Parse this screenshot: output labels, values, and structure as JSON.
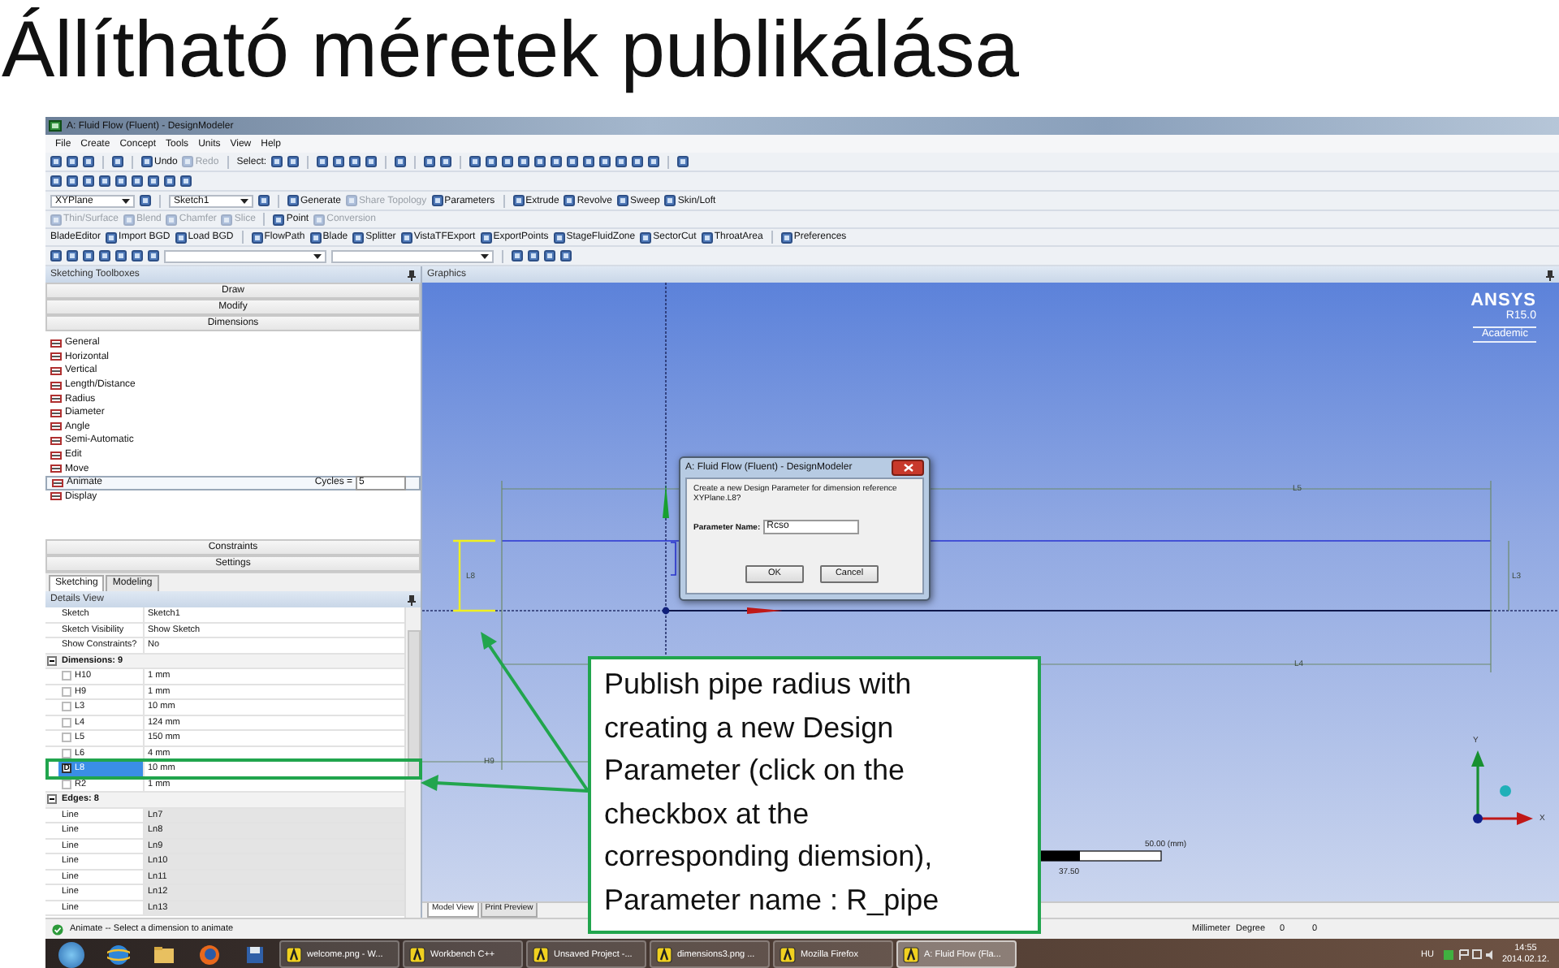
{
  "slide_title": "Állítható méretek publikálása",
  "window": {
    "title": "A: Fluid Flow (Fluent) - DesignModeler"
  },
  "menu": [
    "File",
    "Create",
    "Concept",
    "Tools",
    "Units",
    "View",
    "Help"
  ],
  "toolbars": [
    [
      {
        "kind": "icon"
      },
      {
        "kind": "icon"
      },
      {
        "kind": "icon"
      },
      {
        "kind": "separator"
      },
      {
        "kind": "icon"
      },
      {
        "kind": "separator"
      },
      {
        "kind": "button",
        "label": "Undo",
        "disabled": false
      },
      {
        "kind": "button",
        "label": "Redo",
        "disabled": true
      },
      {
        "kind": "separator"
      },
      {
        "kind": "label",
        "label": "Select:"
      },
      {
        "kind": "icon"
      },
      {
        "kind": "icon"
      },
      {
        "kind": "separator"
      },
      {
        "kind": "icon"
      },
      {
        "kind": "icon"
      },
      {
        "kind": "icon"
      },
      {
        "kind": "icon"
      },
      {
        "kind": "separator"
      },
      {
        "kind": "icon"
      },
      {
        "kind": "separator"
      },
      {
        "kind": "icon"
      },
      {
        "kind": "icon"
      },
      {
        "kind": "separator"
      },
      {
        "kind": "icon"
      },
      {
        "kind": "icon"
      },
      {
        "kind": "icon"
      },
      {
        "kind": "icon"
      },
      {
        "kind": "icon"
      },
      {
        "kind": "icon"
      },
      {
        "kind": "icon"
      },
      {
        "kind": "icon"
      },
      {
        "kind": "icon"
      },
      {
        "kind": "icon"
      },
      {
        "kind": "icon"
      },
      {
        "kind": "icon"
      },
      {
        "kind": "separator"
      },
      {
        "kind": "icon"
      }
    ],
    [
      {
        "kind": "icon"
      },
      {
        "kind": "icon"
      },
      {
        "kind": "icon"
      },
      {
        "kind": "icon"
      },
      {
        "kind": "icon"
      },
      {
        "kind": "icon"
      },
      {
        "kind": "icon"
      },
      {
        "kind": "icon"
      },
      {
        "kind": "icon"
      }
    ],
    [
      {
        "kind": "dropdown",
        "value": "XYPlane"
      },
      {
        "kind": "icon"
      },
      {
        "kind": "separator"
      },
      {
        "kind": "dropdown",
        "value": "Sketch1"
      },
      {
        "kind": "icon"
      },
      {
        "kind": "separator"
      },
      {
        "kind": "button",
        "label": "Generate",
        "disabled": false
      },
      {
        "kind": "button",
        "label": "Share Topology",
        "disabled": true
      },
      {
        "kind": "button",
        "label": "Parameters",
        "disabled": false
      },
      {
        "kind": "separator"
      },
      {
        "kind": "button",
        "label": "Extrude",
        "disabled": false
      },
      {
        "kind": "button",
        "label": "Revolve",
        "disabled": false
      },
      {
        "kind": "button",
        "label": "Sweep",
        "disabled": false
      },
      {
        "kind": "button",
        "label": "Skin/Loft",
        "disabled": false
      }
    ],
    [
      {
        "kind": "button",
        "label": "Thin/Surface",
        "disabled": true
      },
      {
        "kind": "button",
        "label": "Blend",
        "disabled": true
      },
      {
        "kind": "button",
        "label": "Chamfer",
        "disabled": true
      },
      {
        "kind": "button",
        "label": "Slice",
        "disabled": true
      },
      {
        "kind": "separator"
      },
      {
        "kind": "button",
        "label": "Point",
        "disabled": false
      },
      {
        "kind": "button",
        "label": "Conversion",
        "disabled": true
      }
    ],
    [
      {
        "kind": "label",
        "label": "BladeEditor"
      },
      {
        "kind": "button",
        "label": "Import BGD",
        "disabled": false
      },
      {
        "kind": "button",
        "label": "Load BGD",
        "disabled": false
      },
      {
        "kind": "separator"
      },
      {
        "kind": "button",
        "label": "FlowPath",
        "disabled": false
      },
      {
        "kind": "button",
        "label": "Blade",
        "disabled": false
      },
      {
        "kind": "button",
        "label": "Splitter",
        "disabled": false
      },
      {
        "kind": "button",
        "label": "VistaTFExport",
        "disabled": false
      },
      {
        "kind": "button",
        "label": "ExportPoints",
        "disabled": false
      },
      {
        "kind": "button",
        "label": "StageFluidZone",
        "disabled": false
      },
      {
        "kind": "button",
        "label": "SectorCut",
        "disabled": false
      },
      {
        "kind": "button",
        "label": "ThroatArea",
        "disabled": false
      },
      {
        "kind": "separator"
      },
      {
        "kind": "button",
        "label": "Preferences",
        "disabled": false
      }
    ],
    [
      {
        "kind": "icon"
      },
      {
        "kind": "icon"
      },
      {
        "kind": "icon"
      },
      {
        "kind": "icon"
      },
      {
        "kind": "icon"
      },
      {
        "kind": "icon"
      },
      {
        "kind": "icon"
      },
      {
        "kind": "combo"
      },
      {
        "kind": "combo"
      },
      {
        "kind": "separator"
      },
      {
        "kind": "icon"
      },
      {
        "kind": "icon"
      },
      {
        "kind": "icon"
      },
      {
        "kind": "icon"
      }
    ]
  ],
  "toolbox": {
    "title": "Sketching Toolboxes",
    "sections_top": [
      "Draw",
      "Modify",
      "Dimensions"
    ],
    "tools": [
      {
        "label": "General",
        "selected": false
      },
      {
        "label": "Horizontal",
        "selected": false
      },
      {
        "label": "Vertical",
        "selected": false
      },
      {
        "label": "Length/Distance",
        "selected": false
      },
      {
        "label": "Radius",
        "selected": false
      },
      {
        "label": "Diameter",
        "selected": false
      },
      {
        "label": "Angle",
        "selected": false
      },
      {
        "label": "Semi-Automatic",
        "selected": false
      },
      {
        "label": "Edit",
        "selected": false
      },
      {
        "label": "Move",
        "selected": false
      },
      {
        "label": "Animate",
        "selected": true,
        "field_label": "Cycles =",
        "field_value": "5"
      },
      {
        "label": "Display",
        "selected": false
      }
    ],
    "sections_bottom": [
      "Constraints",
      "Settings"
    ],
    "tabs": [
      {
        "label": "Sketching",
        "selected": true
      },
      {
        "label": "Modeling",
        "selected": false
      }
    ]
  },
  "details": {
    "title": "Details View",
    "rows": [
      {
        "kind": "prop",
        "name": "Sketch",
        "value": "Sketch1"
      },
      {
        "kind": "prop",
        "name": "Sketch Visibility",
        "value": "Show Sketch"
      },
      {
        "kind": "prop",
        "name": "Show Constraints?",
        "value": "No"
      },
      {
        "kind": "group",
        "label": "Dimensions: 9",
        "expanded": true
      },
      {
        "kind": "param",
        "name": "H10",
        "value": "1 mm",
        "checked": false,
        "selected": false
      },
      {
        "kind": "param",
        "name": "H9",
        "value": "1 mm",
        "checked": false,
        "selected": false
      },
      {
        "kind": "param",
        "name": "L3",
        "value": "10 mm",
        "checked": false,
        "selected": false
      },
      {
        "kind": "param",
        "name": "L4",
        "value": "124 mm",
        "checked": false,
        "selected": false
      },
      {
        "kind": "param",
        "name": "L5",
        "value": "150 mm",
        "checked": false,
        "selected": false
      },
      {
        "kind": "param",
        "name": "L6",
        "value": "4 mm",
        "checked": false,
        "selected": false
      },
      {
        "kind": "param",
        "name": "L8",
        "value": "10 mm",
        "checked": true,
        "check_label": "D",
        "selected": true
      },
      {
        "kind": "param",
        "name": "R2",
        "value": "1 mm",
        "checked": false,
        "selected": false
      },
      {
        "kind": "group",
        "label": "Edges: 8",
        "expanded": true
      },
      {
        "kind": "edge",
        "name": "Line",
        "value": "Ln7"
      },
      {
        "kind": "edge",
        "name": "Line",
        "value": "Ln8"
      },
      {
        "kind": "edge",
        "name": "Line",
        "value": "Ln9"
      },
      {
        "kind": "edge",
        "name": "Line",
        "value": "Ln10"
      },
      {
        "kind": "edge",
        "name": "Line",
        "value": "Ln11"
      },
      {
        "kind": "edge",
        "name": "Line",
        "value": "Ln12"
      },
      {
        "kind": "edge",
        "name": "Line",
        "value": "Ln13"
      }
    ]
  },
  "graphics": {
    "title": "Graphics",
    "logo": {
      "brand": "ANSYS",
      "version": "R15.0",
      "edition": "Academic"
    },
    "dimension_labels": [
      "L5",
      "L8",
      "L3",
      "L4",
      "H9"
    ],
    "scale": {
      "end_label": "50.00 (mm)",
      "mid_label": "37.50"
    },
    "axes": {
      "y": "Y",
      "x": "X"
    },
    "tabs": [
      {
        "label": "Model View",
        "selected": true
      },
      {
        "label": "Print Preview",
        "selected": false
      }
    ]
  },
  "dialog": {
    "title": "A: Fluid Flow (Fluent) - DesignModeler",
    "message": "Create a new Design Parameter for dimension reference XYPlane.L8?",
    "field_label": "Parameter Name:",
    "field_value": "Rcso",
    "buttons": [
      "OK",
      "Cancel"
    ]
  },
  "status_bar": {
    "message": "Animate -- Select a dimension to animate",
    "units": [
      "Millimeter",
      "Degree"
    ],
    "values": [
      "0",
      "0"
    ]
  },
  "taskbar": {
    "tasks": [
      {
        "label": "welcome.png - W...",
        "selected": false
      },
      {
        "label": "Workbench C++",
        "selected": false
      },
      {
        "label": "Unsaved Project -...",
        "selected": false
      },
      {
        "label": "dimensions3.png ...",
        "selected": false
      },
      {
        "label": "Mozilla Firefox",
        "selected": false
      },
      {
        "label": "A: Fluid Flow (Fla...",
        "selected": true
      }
    ],
    "language": "HU",
    "time": "14:55",
    "date": "2014.02.12."
  },
  "callout": {
    "text": "Publish pipe radius with\ncreating a new Design\nParameter (click on the\ncheckbox at the\ncorresponding diemsion),\nParameter name : R_pipe"
  }
}
